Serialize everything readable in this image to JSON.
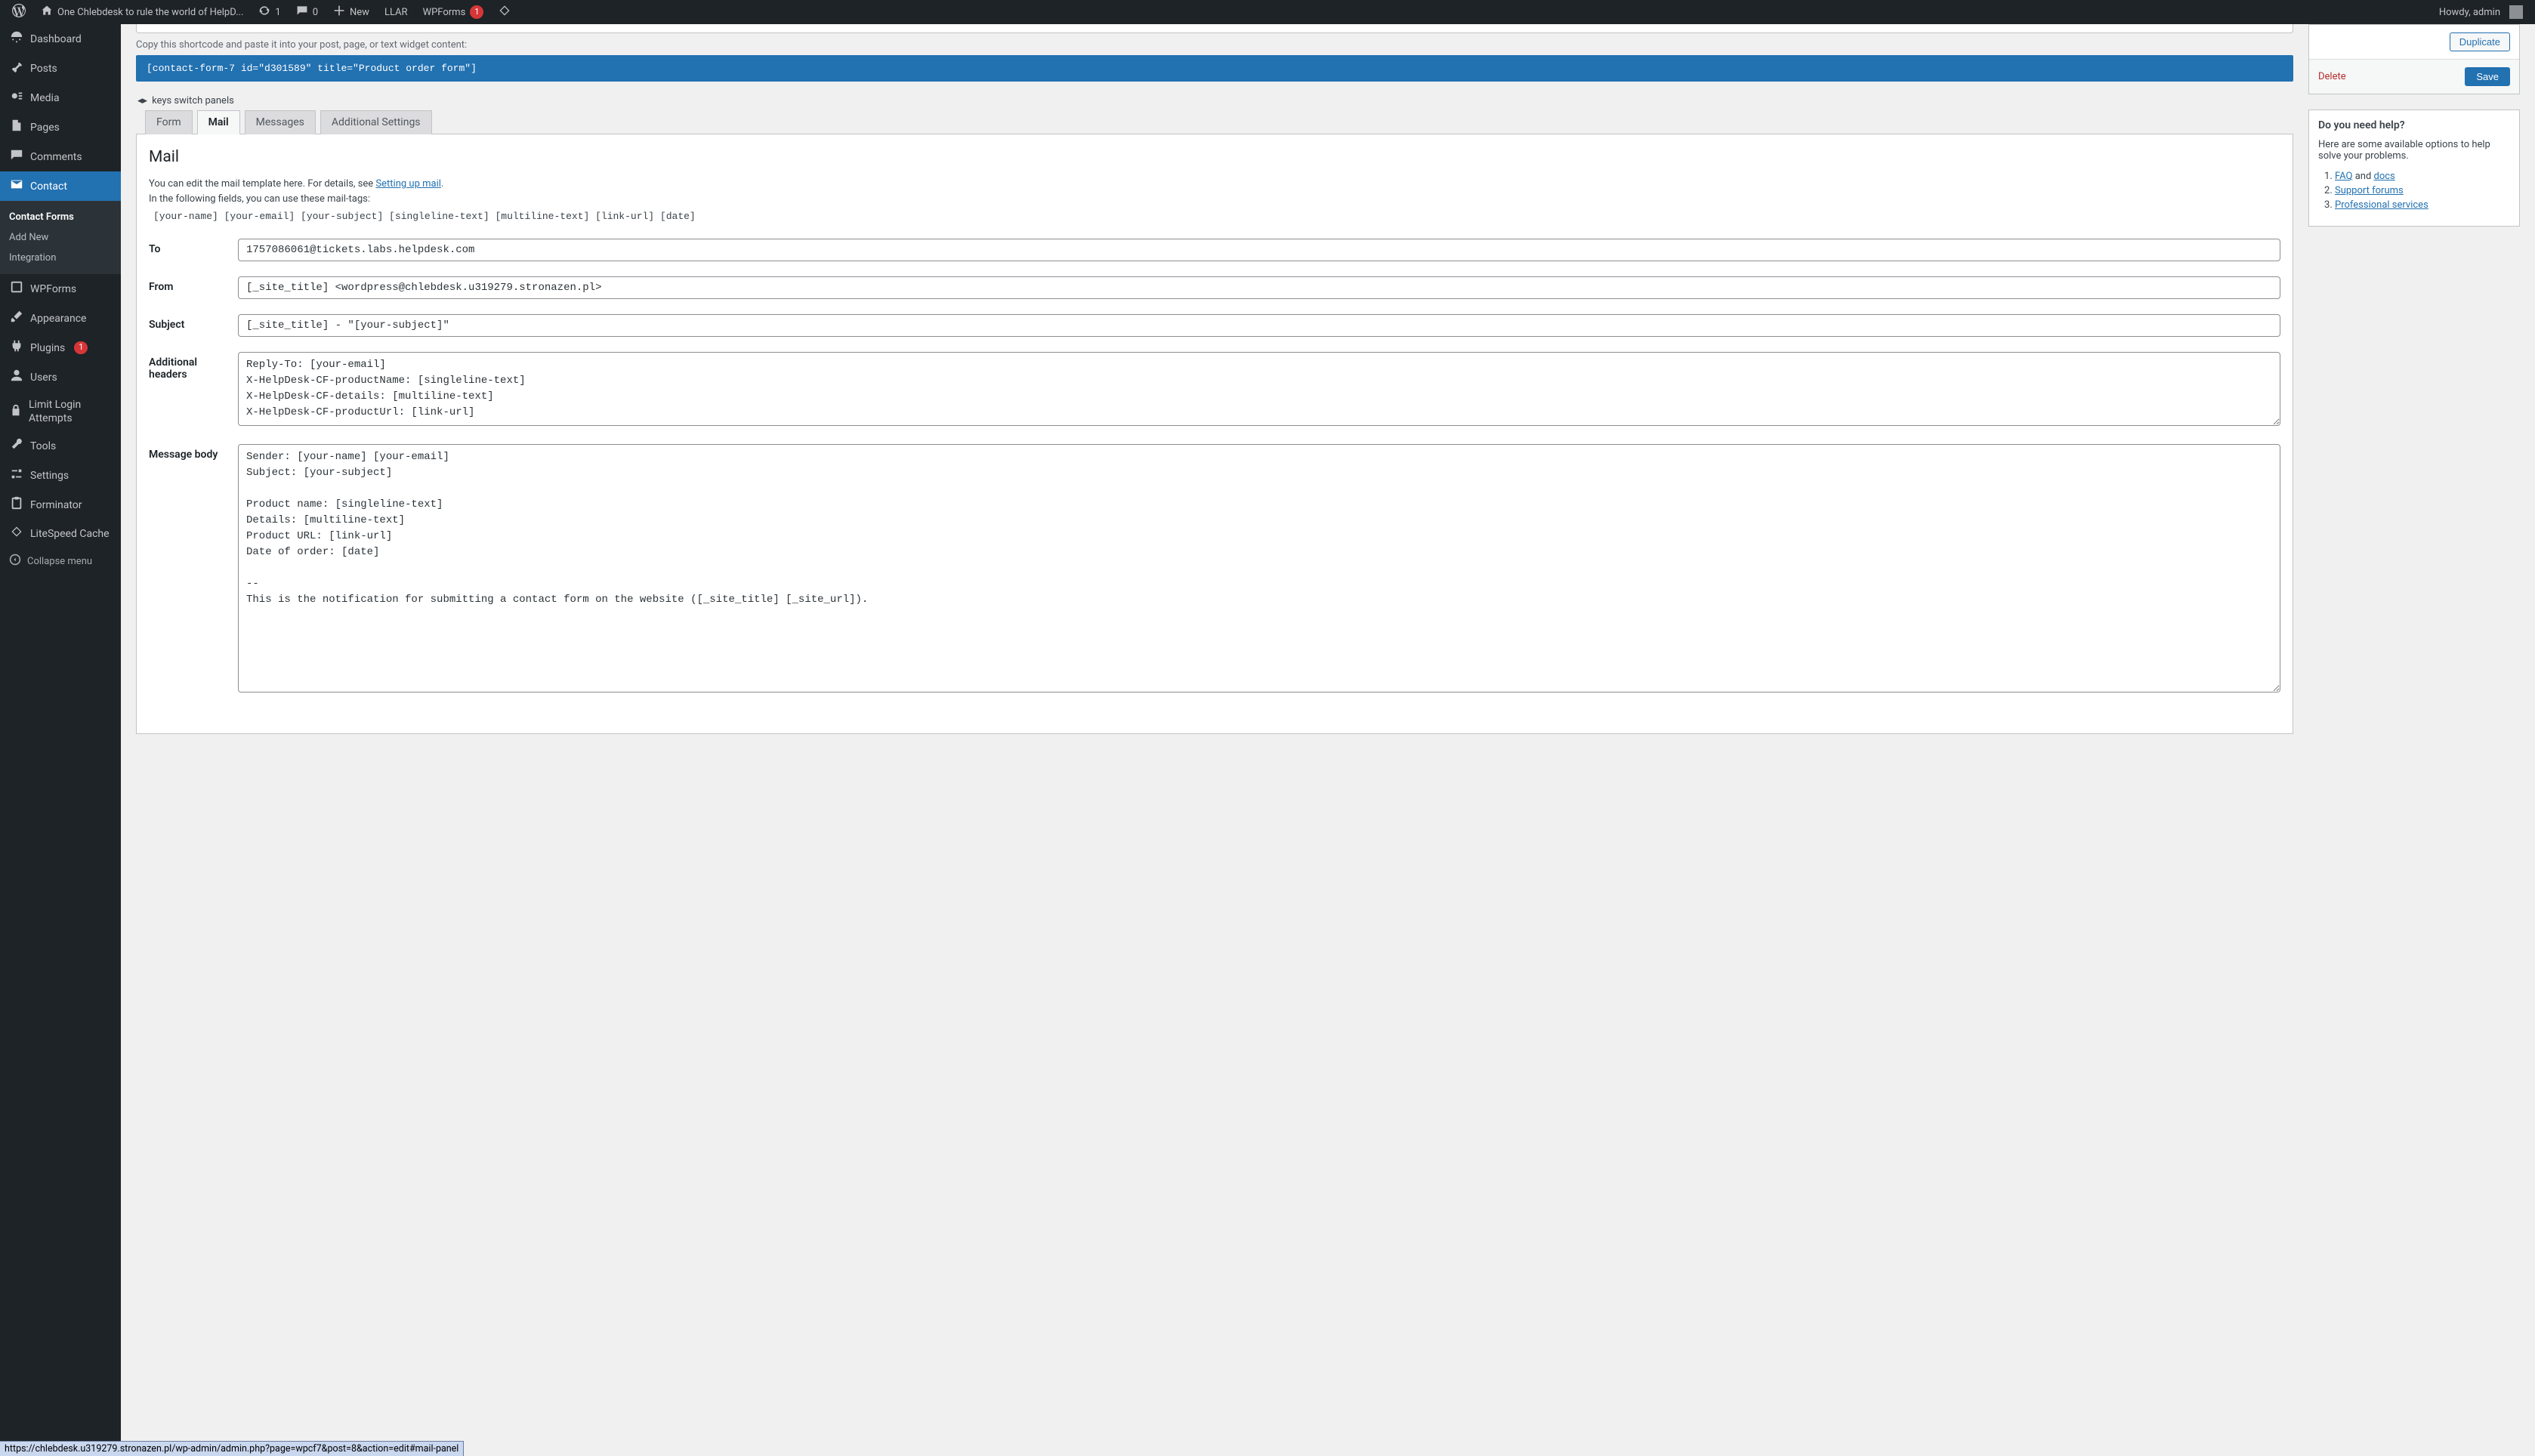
{
  "adminbar": {
    "site_title": "One Chlebdesk to rule the world of HelpD...",
    "updates": "1",
    "comments": "0",
    "new": "New",
    "llar": "LLAR",
    "wpforms": "WPForms",
    "wpforms_badge": "1",
    "howdy": "Howdy, admin"
  },
  "sidebar": {
    "dashboard": "Dashboard",
    "posts": "Posts",
    "media": "Media",
    "pages": "Pages",
    "comments": "Comments",
    "contact": "Contact",
    "contact_forms": "Contact Forms",
    "add_new": "Add New",
    "integration": "Integration",
    "wpforms": "WPForms",
    "appearance": "Appearance",
    "plugins": "Plugins",
    "plugins_badge": "1",
    "users": "Users",
    "limit_login": "Limit Login Attempts",
    "tools": "Tools",
    "settings": "Settings",
    "forminator": "Forminator",
    "litespeed": "LiteSpeed Cache",
    "collapse": "Collapse menu"
  },
  "shortcode": {
    "hint": "Copy this shortcode and paste it into your post, page, or text widget content:",
    "code": "[contact-form-7 id=\"d301589\" title=\"Product order form\"]"
  },
  "keys_hint": "keys switch panels",
  "tabs": {
    "form": "Form",
    "mail": "Mail",
    "messages": "Messages",
    "additional": "Additional Settings"
  },
  "mail_panel": {
    "title": "Mail",
    "desc1": "You can edit the mail template here. For details, see ",
    "desc1_link": "Setting up mail",
    "desc2": "In the following fields, you can use these mail-tags:",
    "tags": "[your-name] [your-email] [your-subject] [singleline-text] [multiline-text] [link-url] [date]",
    "labels": {
      "to": "To",
      "from": "From",
      "subject": "Subject",
      "headers": "Additional headers",
      "body": "Message body"
    },
    "values": {
      "to": "1757086061@tickets.labs.helpdesk.com",
      "from": "[_site_title] <wordpress@chlebdesk.u319279.stronazen.pl>",
      "subject": "[_site_title] - \"[your-subject]\"",
      "headers": "Reply-To: [your-email]\nX-HelpDesk-CF-productName: [singleline-text]\nX-HelpDesk-CF-details: [multiline-text]\nX-HelpDesk-CF-productUrl: [link-url]",
      "body": "Sender: [your-name] [your-email]\nSubject: [your-subject]\n\nProduct name: [singleline-text]\nDetails: [multiline-text]\nProduct URL: [link-url]\nDate of order: [date]\n\n-- \nThis is the notification for submitting a contact form on the website ([_site_title] [_site_url])."
    }
  },
  "actions": {
    "duplicate": "Duplicate",
    "delete": "Delete",
    "save": "Save"
  },
  "help": {
    "title": "Do you need help?",
    "intro": "Here are some available options to help solve your problems.",
    "faq": "FAQ",
    "and": " and ",
    "docs": "docs",
    "forums": "Support forums",
    "pro": "Professional services"
  },
  "status_url": "https://chlebdesk.u319279.stronazen.pl/wp-admin/admin.php?page=wpcf7&post=8&action=edit#mail-panel"
}
